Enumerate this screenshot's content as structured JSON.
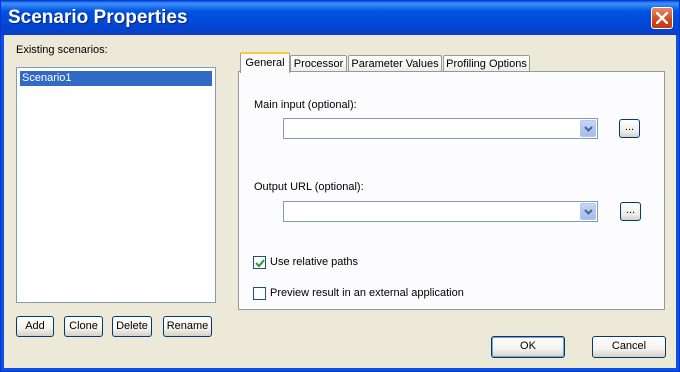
{
  "window": {
    "title": "Scenario Properties"
  },
  "left": {
    "list_label": "Existing scenarios:",
    "scenarios": [
      "Scenario1"
    ],
    "buttons": {
      "add": "Add",
      "clone": "Clone",
      "delete": "Delete",
      "rename": "Rename"
    }
  },
  "tabs": [
    "General",
    "Processor",
    "Parameter Values",
    "Profiling Options"
  ],
  "active_tab": "General",
  "general": {
    "main_input_label": "Main input (optional):",
    "main_input_value": "",
    "output_url_label": "Output URL (optional):",
    "output_url_value": "",
    "browse_label": "...",
    "use_relative_paths_label": "Use relative paths",
    "use_relative_paths_checked": true,
    "preview_external_label": "Preview result in an external application",
    "preview_external_checked": false
  },
  "footer": {
    "ok": "OK",
    "cancel": "Cancel"
  }
}
